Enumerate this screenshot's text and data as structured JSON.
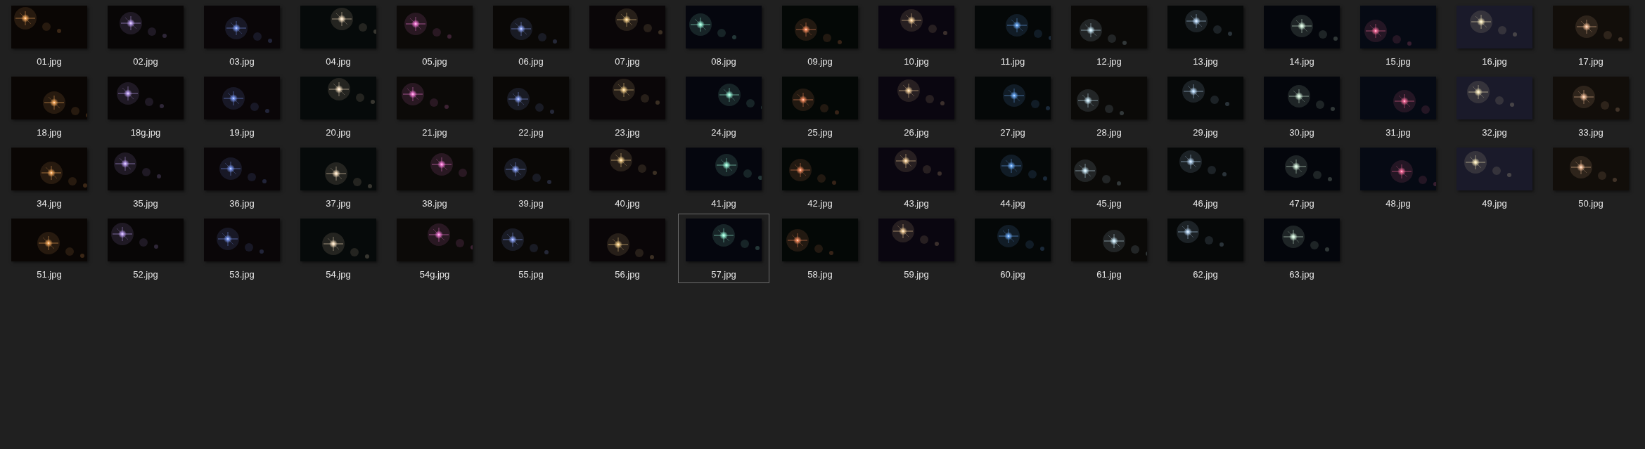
{
  "files": [
    {
      "name": "01.jpg",
      "selected": false
    },
    {
      "name": "02.jpg",
      "selected": false
    },
    {
      "name": "03.jpg",
      "selected": false
    },
    {
      "name": "04.jpg",
      "selected": false
    },
    {
      "name": "05.jpg",
      "selected": false
    },
    {
      "name": "06.jpg",
      "selected": false
    },
    {
      "name": "07.jpg",
      "selected": false
    },
    {
      "name": "08.jpg",
      "selected": false
    },
    {
      "name": "09.jpg",
      "selected": false
    },
    {
      "name": "10.jpg",
      "selected": false
    },
    {
      "name": "11.jpg",
      "selected": false
    },
    {
      "name": "12.jpg",
      "selected": false
    },
    {
      "name": "13.jpg",
      "selected": false
    },
    {
      "name": "14.jpg",
      "selected": false
    },
    {
      "name": "15.jpg",
      "selected": false
    },
    {
      "name": "16.jpg",
      "selected": false
    },
    {
      "name": "17.jpg",
      "selected": false
    },
    {
      "name": "18.jpg",
      "selected": false
    },
    {
      "name": "18g.jpg",
      "selected": false
    },
    {
      "name": "19.jpg",
      "selected": false
    },
    {
      "name": "20.jpg",
      "selected": false
    },
    {
      "name": "21.jpg",
      "selected": false
    },
    {
      "name": "22.jpg",
      "selected": false
    },
    {
      "name": "23.jpg",
      "selected": false
    },
    {
      "name": "24.jpg",
      "selected": false
    },
    {
      "name": "25.jpg",
      "selected": false
    },
    {
      "name": "26.jpg",
      "selected": false
    },
    {
      "name": "27.jpg",
      "selected": false
    },
    {
      "name": "28.jpg",
      "selected": false
    },
    {
      "name": "29.jpg",
      "selected": false
    },
    {
      "name": "30.jpg",
      "selected": false
    },
    {
      "name": "31.jpg",
      "selected": false
    },
    {
      "name": "32.jpg",
      "selected": false
    },
    {
      "name": "33.jpg",
      "selected": false
    },
    {
      "name": "34.jpg",
      "selected": false
    },
    {
      "name": "35.jpg",
      "selected": false
    },
    {
      "name": "36.jpg",
      "selected": false
    },
    {
      "name": "37.jpg",
      "selected": false
    },
    {
      "name": "38.jpg",
      "selected": false
    },
    {
      "name": "39.jpg",
      "selected": false
    },
    {
      "name": "40.jpg",
      "selected": false
    },
    {
      "name": "41.jpg",
      "selected": false
    },
    {
      "name": "42.jpg",
      "selected": false
    },
    {
      "name": "43.jpg",
      "selected": false
    },
    {
      "name": "44.jpg",
      "selected": false
    },
    {
      "name": "45.jpg",
      "selected": false
    },
    {
      "name": "46.jpg",
      "selected": false
    },
    {
      "name": "47.jpg",
      "selected": false
    },
    {
      "name": "48.jpg",
      "selected": false
    },
    {
      "name": "49.jpg",
      "selected": false
    },
    {
      "name": "50.jpg",
      "selected": false
    },
    {
      "name": "51.jpg",
      "selected": false
    },
    {
      "name": "52.jpg",
      "selected": false
    },
    {
      "name": "53.jpg",
      "selected": false
    },
    {
      "name": "54.jpg",
      "selected": false
    },
    {
      "name": "54g.jpg",
      "selected": false
    },
    {
      "name": "55.jpg",
      "selected": false
    },
    {
      "name": "56.jpg",
      "selected": false
    },
    {
      "name": "57.jpg",
      "selected": true
    },
    {
      "name": "58.jpg",
      "selected": false
    },
    {
      "name": "59.jpg",
      "selected": false
    },
    {
      "name": "60.jpg",
      "selected": false
    },
    {
      "name": "61.jpg",
      "selected": false
    },
    {
      "name": "62.jpg",
      "selected": false
    },
    {
      "name": "63.jpg",
      "selected": false
    }
  ]
}
